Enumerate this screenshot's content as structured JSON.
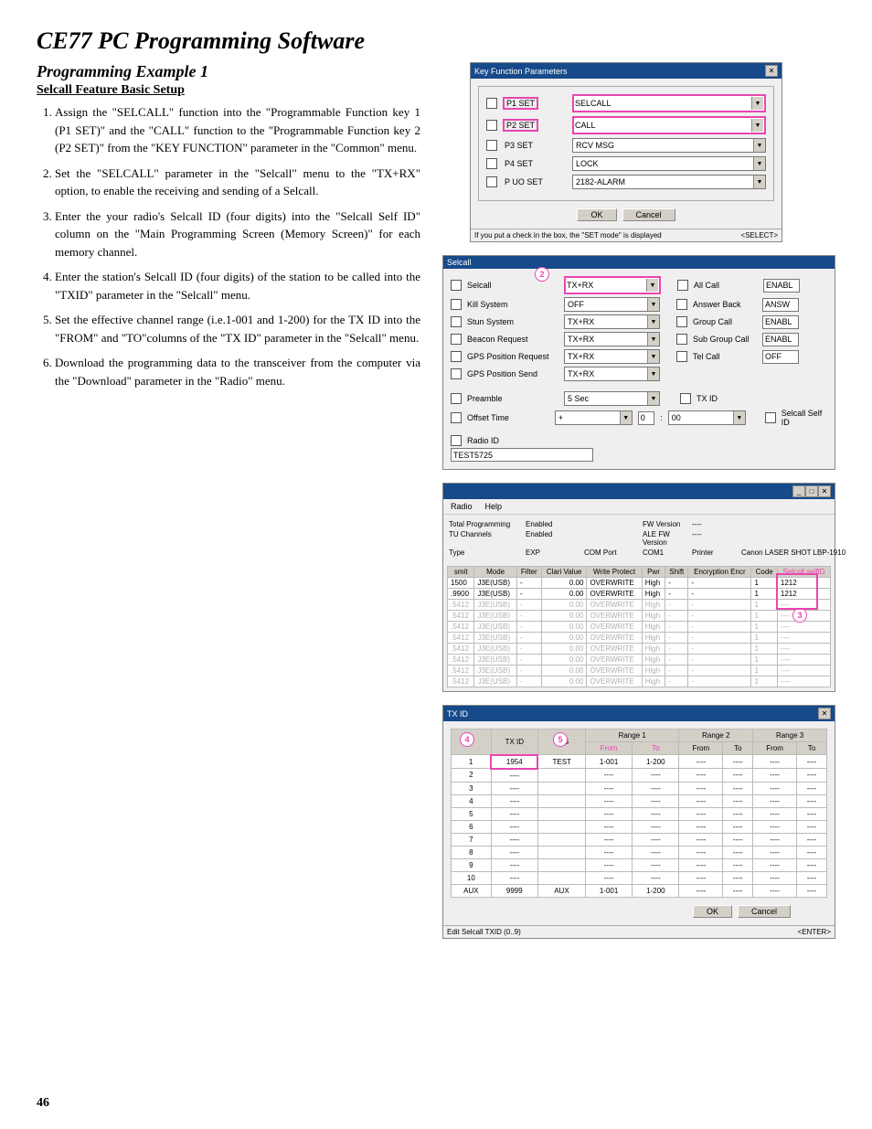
{
  "title": "CE77 PC Programming Software",
  "subtitle": "Programming Example 1",
  "section": "Selcall Feature Basic Setup",
  "steps": [
    "Assign the \"SELCALL\" function into the \"Programmable Function key 1 (P1 SET)\" and the \"CALL\" function to the \"Programmable Function key 2 (P2 SET)\" from the \"KEY FUNCTION\" parameter in the \"Common\" menu.",
    "Set the \"SELCALL\" parameter in the \"Selcall\" menu to the \"TX+RX\" option, to enable the receiving and sending of a Selcall.",
    "Enter the your radio's Selcall ID (four digits) into the \"Selcall Self ID\" column on the \"Main Programming Screen (Memory Screen)\" for each memory channel.",
    "Enter the station's Selcall ID (four digits) of the station to be called into the \"TXID\" parameter in the \"Selcall\" menu.",
    "Set the effective channel range (i.e.1-001 and 1-200) for the TX ID into the \"FROM\" and \"TO\"columns of the \"TX ID\" parameter in the \"Selcall\" menu.",
    "Download the programming data to the transceiver from the computer via the \"Download\" parameter in the \"Radio\" menu."
  ],
  "page_number": "46",
  "panel1": {
    "title": "Key Function Parameters",
    "rows": [
      {
        "label": "P1 SET",
        "value": "SELCALL"
      },
      {
        "label": "P2 SET",
        "value": "CALL"
      },
      {
        "label": "P3 SET",
        "value": "RCV MSG"
      },
      {
        "label": "P4 SET",
        "value": "LOCK"
      },
      {
        "label": "P UO SET",
        "value": "2182-ALARM"
      }
    ],
    "ok": "OK",
    "cancel": "Cancel",
    "status_left": "If you put a check in the box, the \"SET mode\" is displayed",
    "status_right": "<SELECT>"
  },
  "panel2": {
    "title": "Selcall",
    "leftRows": [
      {
        "label": "Selcall",
        "value": "TX+RX",
        "pink": true
      },
      {
        "label": "Kill System",
        "value": "OFF"
      },
      {
        "label": "Stun System",
        "value": "TX+RX"
      },
      {
        "label": "Beacon Request",
        "value": "TX+RX"
      },
      {
        "label": "GPS Position Request",
        "value": "TX+RX"
      },
      {
        "label": "GPS Position Send",
        "value": "TX+RX"
      }
    ],
    "rightRows": [
      {
        "label": "All Call",
        "value": "ENABL"
      },
      {
        "label": "Answer Back",
        "value": "ANSW"
      },
      {
        "label": "Group Call",
        "value": "ENABL"
      },
      {
        "label": "Sub Group Call",
        "value": "ENABL"
      },
      {
        "label": "Tel Call",
        "value": "OFF"
      }
    ],
    "preamble_label": "Preamble",
    "preamble_value": "5 Sec",
    "offset_label": "Offset Time",
    "offset_sign": "+",
    "offset_h": "0",
    "offset_m": "00",
    "txid_label": "TX ID",
    "selfid_label": "Selcall Self ID",
    "radioid_label": "Radio ID",
    "radioid_value": "TEST5725"
  },
  "panel3": {
    "menu": [
      "Radio",
      "Help"
    ],
    "info": {
      "r1c1": "Total Programming",
      "r1c2": "Enabled",
      "r1c3": "FW Version",
      "r1c4": "----",
      "r2c1": "TU Channels",
      "r2c2": "Enabled",
      "r2c3": "ALE FW Version",
      "r2c4": "----",
      "r3c1": "Type",
      "r3c2": "EXP",
      "r3c3": "COM Port",
      "r3c4": "COM1",
      "r3c5": "Printer",
      "r3c6": "Canon LASER SHOT LBP-1910"
    },
    "headers": [
      "smit",
      "Mode",
      "Filter",
      "Clari Value",
      "Write Protect",
      "Pwr",
      "Shift",
      "Encryption Encr",
      "Code",
      "Selcall selfID"
    ],
    "rows": [
      {
        "f": "1500",
        "mode": "J3E(USB)",
        "filter": "-",
        "clar": "0.00",
        "wp": "OVERWRITE",
        "pwr": "High",
        "shift": "-",
        "encr": "-",
        "code": "1",
        "sid": "1212",
        "faded": false
      },
      {
        "f": ".9900",
        "mode": "J3E(USB)",
        "filter": "-",
        "clar": "0.00",
        "wp": "OVERWRITE",
        "pwr": "High",
        "shift": "-",
        "encr": "-",
        "code": "1",
        "sid": "1212",
        "faded": false
      },
      {
        "f": ".5412",
        "mode": "J3E(USB)",
        "filter": "-",
        "clar": "0.00",
        "wp": "OVERWRITE",
        "pwr": "High",
        "shift": "-",
        "encr": "-",
        "code": "1",
        "sid": "----",
        "faded": true
      },
      {
        "f": ".5412",
        "mode": "J3E(USB)",
        "filter": "-",
        "clar": "0.00",
        "wp": "OVERWRITE",
        "pwr": "High",
        "shift": "-",
        "encr": "-",
        "code": "1",
        "sid": "----",
        "faded": true
      },
      {
        "f": ".5412",
        "mode": "J3E(USB)",
        "filter": "-",
        "clar": "0.00",
        "wp": "OVERWRITE",
        "pwr": "High",
        "shift": "-",
        "encr": "-",
        "code": "1",
        "sid": "----",
        "faded": true
      },
      {
        "f": ".5412",
        "mode": "J3E(USB)",
        "filter": "-",
        "clar": "0.00",
        "wp": "OVERWRITE",
        "pwr": "High",
        "shift": "-",
        "encr": "-",
        "code": "1",
        "sid": "----",
        "faded": true
      },
      {
        "f": ".5412",
        "mode": "J3E(USB)",
        "filter": "-",
        "clar": "0.00",
        "wp": "OVERWRITE",
        "pwr": "High",
        "shift": "-",
        "encr": "-",
        "code": "1",
        "sid": "----",
        "faded": true
      },
      {
        "f": ".5412",
        "mode": "J3E(USB)",
        "filter": "-",
        "clar": "0.00",
        "wp": "OVERWRITE",
        "pwr": "High",
        "shift": "-",
        "encr": "-",
        "code": "1",
        "sid": "----",
        "faded": true
      },
      {
        "f": ".5412",
        "mode": "J3E(USB)",
        "filter": "-",
        "clar": "0.00",
        "wp": "OVERWRITE",
        "pwr": "High",
        "shift": "-",
        "encr": "-",
        "code": "1",
        "sid": "----",
        "faded": true
      },
      {
        "f": ".5412",
        "mode": "J3E(USB)",
        "filter": "-",
        "clar": "0.00",
        "wp": "OVERWRITE",
        "pwr": "High",
        "shift": "-",
        "encr": "-",
        "code": "1",
        "sid": "----",
        "faded": true
      }
    ]
  },
  "panel4": {
    "title": "TX ID",
    "col_txid": "TX ID",
    "col_tag": "TAG",
    "col_r1": "Range 1",
    "col_r2": "Range 2",
    "col_r3": "Range 3",
    "col_from": "From",
    "col_to": "To",
    "rows": [
      {
        "n": "1",
        "txid": "1954",
        "tag": "TEST",
        "r1f": "1-001",
        "r1t": "1-200",
        "r2f": "----",
        "r2t": "----",
        "r3f": "----",
        "r3t": "----"
      },
      {
        "n": "2",
        "txid": "----",
        "tag": "",
        "r1f": "----",
        "r1t": "----",
        "r2f": "----",
        "r2t": "----",
        "r3f": "----",
        "r3t": "----"
      },
      {
        "n": "3",
        "txid": "----",
        "tag": "",
        "r1f": "----",
        "r1t": "----",
        "r2f": "----",
        "r2t": "----",
        "r3f": "----",
        "r3t": "----"
      },
      {
        "n": "4",
        "txid": "----",
        "tag": "",
        "r1f": "----",
        "r1t": "----",
        "r2f": "----",
        "r2t": "----",
        "r3f": "----",
        "r3t": "----"
      },
      {
        "n": "5",
        "txid": "----",
        "tag": "",
        "r1f": "----",
        "r1t": "----",
        "r2f": "----",
        "r2t": "----",
        "r3f": "----",
        "r3t": "----"
      },
      {
        "n": "6",
        "txid": "----",
        "tag": "",
        "r1f": "----",
        "r1t": "----",
        "r2f": "----",
        "r2t": "----",
        "r3f": "----",
        "r3t": "----"
      },
      {
        "n": "7",
        "txid": "----",
        "tag": "",
        "r1f": "----",
        "r1t": "----",
        "r2f": "----",
        "r2t": "----",
        "r3f": "----",
        "r3t": "----"
      },
      {
        "n": "8",
        "txid": "----",
        "tag": "",
        "r1f": "----",
        "r1t": "----",
        "r2f": "----",
        "r2t": "----",
        "r3f": "----",
        "r3t": "----"
      },
      {
        "n": "9",
        "txid": "----",
        "tag": "",
        "r1f": "----",
        "r1t": "----",
        "r2f": "----",
        "r2t": "----",
        "r3f": "----",
        "r3t": "----"
      },
      {
        "n": "10",
        "txid": "----",
        "tag": "",
        "r1f": "----",
        "r1t": "----",
        "r2f": "----",
        "r2t": "----",
        "r3f": "----",
        "r3t": "----"
      },
      {
        "n": "AUX",
        "txid": "9999",
        "tag": "AUX",
        "r1f": "1-001",
        "r1t": "1-200",
        "r2f": "----",
        "r2t": "----",
        "r3f": "----",
        "r3t": "----"
      }
    ],
    "ok": "OK",
    "cancel": "Cancel",
    "status_left": "Edit Selcall TXID (0..9)",
    "status_right": "<ENTER>"
  }
}
